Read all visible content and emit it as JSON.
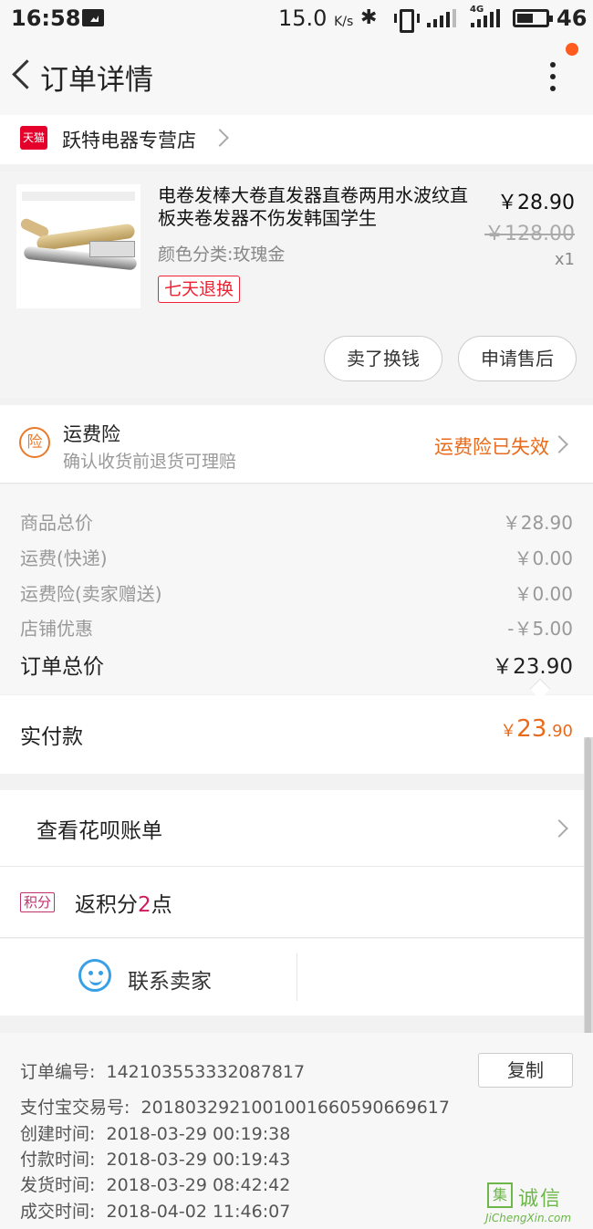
{
  "status_bar": {
    "time": "16:58",
    "speed": "15.0",
    "speed_unit": "K/s",
    "network": "4G",
    "battery": "46"
  },
  "header": {
    "title": "订单详情"
  },
  "store": {
    "badge": "天猫",
    "name": "跃特电器专营店"
  },
  "product": {
    "title": "电卷发棒大卷直发器直卷两用水波纹直板夹卷发器不伤发韩国学生",
    "attribute": "颜色分类:玫瑰金",
    "badge": "七天退换",
    "price": "￥28.90",
    "original_price": "￥128.00",
    "quantity": "x1",
    "sell_button": "卖了换钱",
    "after_sale_button": "申请售后"
  },
  "insurance": {
    "icon_text": "险",
    "title": "运费险",
    "desc": "确认收货前退货可理赔",
    "status": "运费险已失效"
  },
  "summary": {
    "rows": [
      {
        "label": "商品总价",
        "value": "￥28.90"
      },
      {
        "label": "运费(快递)",
        "value": "￥0.00"
      },
      {
        "label": "运费险(卖家赠送)",
        "value": "￥0.00"
      },
      {
        "label": "店铺优惠",
        "value": "-￥5.00"
      }
    ],
    "total_label": "订单总价",
    "total_value": "￥23.90",
    "paid_label": "实付款",
    "paid_currency": "￥",
    "paid_int": "23",
    "paid_dec": ".90"
  },
  "huabei": {
    "label": "查看花呗账单"
  },
  "points": {
    "tag": "积分",
    "prefix": "返积分",
    "count": "2",
    "suffix": "点"
  },
  "contact": {
    "label": "联系卖家"
  },
  "order": {
    "copy_button": "复制",
    "rows": [
      {
        "label": "订单编号:",
        "value": "142103553332087817"
      },
      {
        "label": "支付宝交易号:",
        "value": "2018032921001001660590669617"
      },
      {
        "label": "创建时间:",
        "value": "2018-03-29 00:19:38"
      },
      {
        "label": "付款时间:",
        "value": "2018-03-29 00:19:43"
      },
      {
        "label": "发货时间:",
        "value": "2018-03-29 08:42:42"
      },
      {
        "label": "成交时间:",
        "value": "2018-04-02 11:46:07"
      }
    ]
  },
  "watermark": {
    "mark": "集",
    "text": "诚信",
    "url": "JiChengXin.com"
  },
  "colors": {
    "accent": "#e96a1a",
    "tmall_red": "#e4002b",
    "points_pink": "#d11a5c",
    "contact_blue": "#3aa0e6"
  }
}
